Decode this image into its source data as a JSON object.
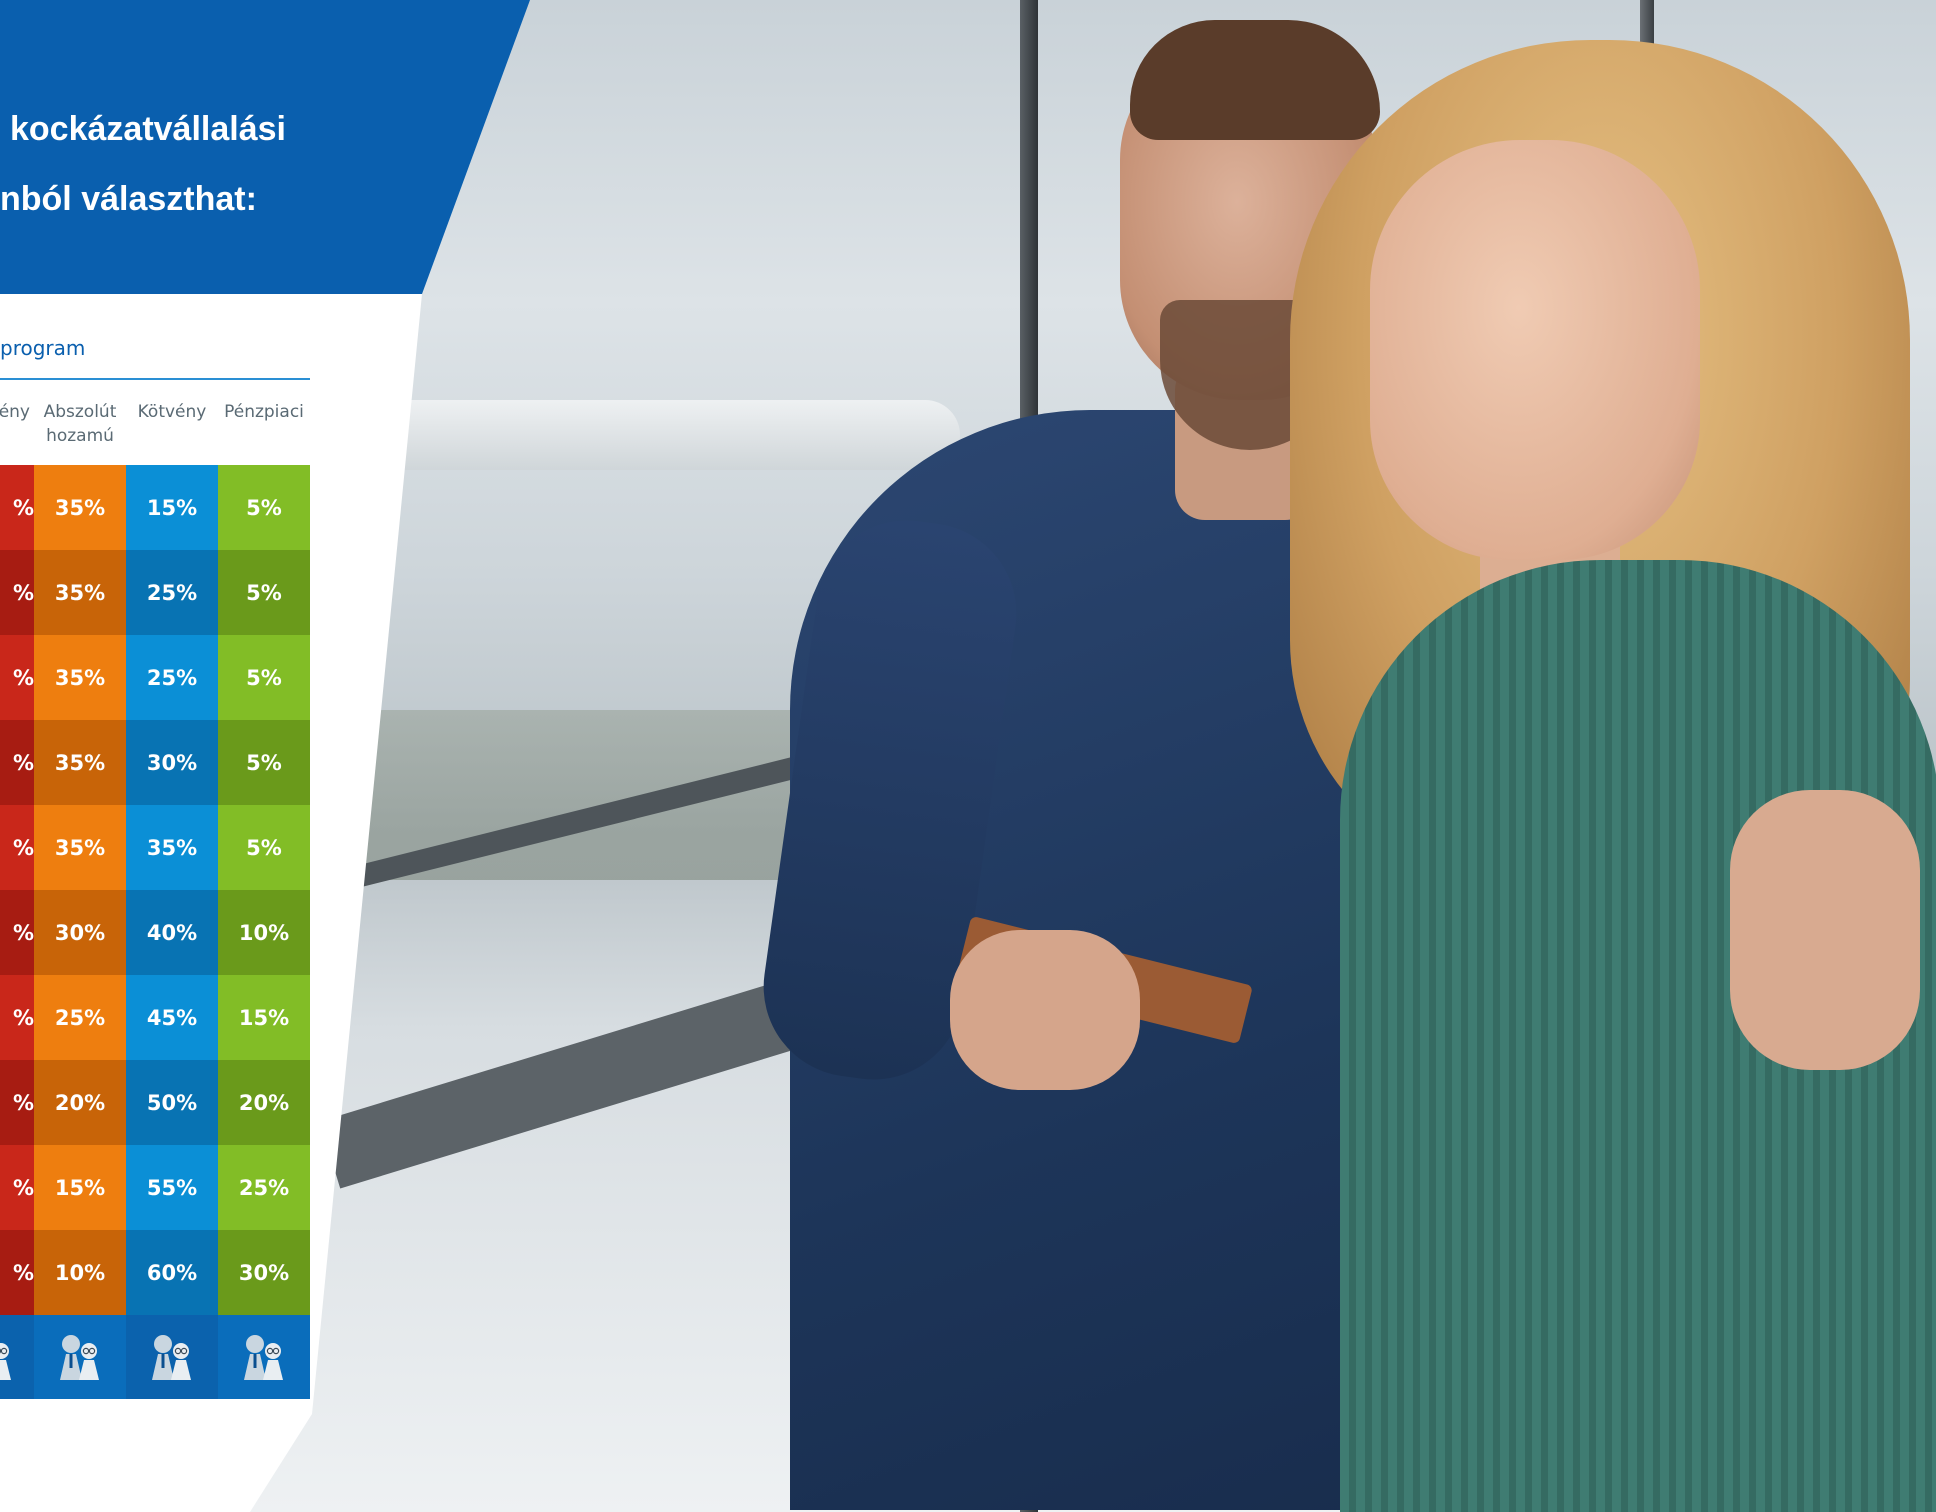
{
  "headline": {
    "line1": "kockázatvállalási",
    "line2": "nból választhat:"
  },
  "table": {
    "title": "program",
    "columns": [
      {
        "label": "ény",
        "label2": ""
      },
      {
        "label": "Abszolút",
        "label2": "hozamú"
      },
      {
        "label": "Kötvény",
        "label2": ""
      },
      {
        "label": "Pénzpiaci",
        "label2": ""
      }
    ],
    "rows": [
      [
        "%",
        "35%",
        "15%",
        "5%"
      ],
      [
        "%",
        "35%",
        "25%",
        "5%"
      ],
      [
        "%",
        "35%",
        "25%",
        "5%"
      ],
      [
        "%",
        "35%",
        "30%",
        "5%"
      ],
      [
        "%",
        "35%",
        "35%",
        "5%"
      ],
      [
        "%",
        "30%",
        "40%",
        "10%"
      ],
      [
        "%",
        "25%",
        "45%",
        "15%"
      ],
      [
        "%",
        "20%",
        "50%",
        "20%"
      ],
      [
        "%",
        "15%",
        "55%",
        "25%"
      ],
      [
        "%",
        "10%",
        "60%",
        "30%"
      ]
    ],
    "footer_icons": [
      "couple-icon",
      "couple-icon",
      "couple-icon",
      "couple-icon"
    ]
  },
  "colors": {
    "brand_blue": "#0a5fae",
    "red": [
      "#c9271a",
      "#a71c12"
    ],
    "orange": [
      "#ee7e0f",
      "#c86408"
    ],
    "blue": [
      "#0b8fd6",
      "#0873b3"
    ],
    "green": [
      "#82bd26",
      "#6a9a1b"
    ],
    "footer_blue": "#0a6dbb"
  }
}
